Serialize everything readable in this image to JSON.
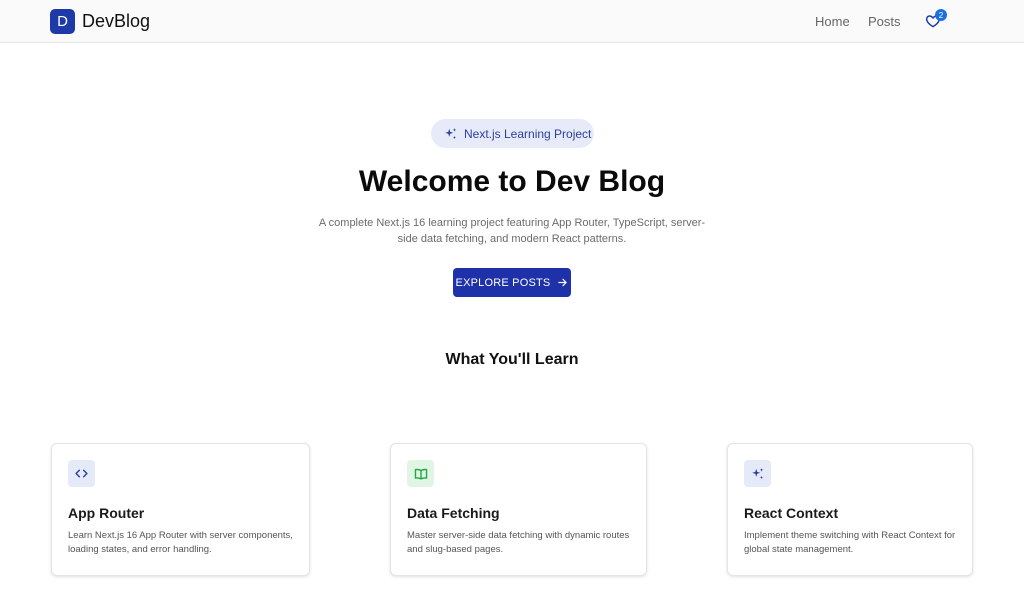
{
  "navbar": {
    "logo_letter": "D",
    "brand": "DevBlog",
    "links": [
      {
        "label": "Home"
      },
      {
        "label": "Posts"
      }
    ],
    "favorites_icon": "heart-icon",
    "favorites_count": "2"
  },
  "hero": {
    "pill_icon": "sparkles-icon",
    "pill_label": "Next.js Learning Project",
    "title": "Welcome to Dev Blog",
    "description": "A complete Next.js 16 learning project featuring App Router, TypeScript, server-side data fetching, and modern React patterns.",
    "cta_label": "EXPLORE POSTS",
    "cta_icon": "arrow-right-icon"
  },
  "features": {
    "title": "What You'll Learn",
    "cards": [
      {
        "icon": "code-icon",
        "title": "App Router",
        "description": "Learn Next.js 16 App Router with server components, loading states, and error handling."
      },
      {
        "icon": "book-icon",
        "title": "Data Fetching",
        "description": "Master server-side data fetching with dynamic routes and slug-based pages."
      },
      {
        "icon": "sparkles-icon",
        "title": "React Context",
        "description": "Implement theme switching with React Context for global state management."
      }
    ]
  },
  "colors": {
    "primary": "#1e31a8",
    "pill_background": "#e7ebf9",
    "badge": "#1d6fe0",
    "icon_green": "#22a845"
  }
}
